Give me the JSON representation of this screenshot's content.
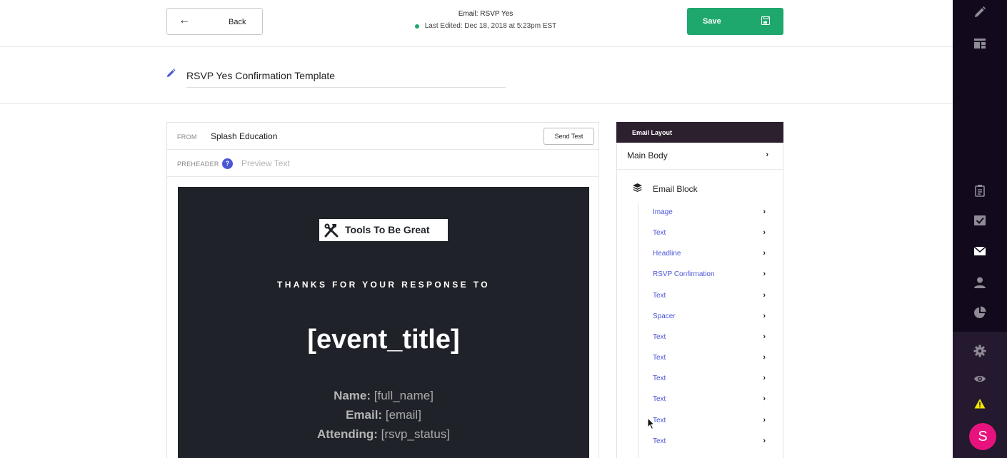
{
  "colors": {
    "accent_green": "#1fa86d",
    "accent_blue": "#4a55d6",
    "link_blue": "#4a55d6",
    "rail_dark": "#120a1c",
    "rail_lower": "#24192e",
    "avatar_pink": "#e8127e",
    "warning_yellow": "#f2e600"
  },
  "header": {
    "back_label": "Back",
    "back_icon": "arrow-left-icon",
    "doc_title": "Email: RSVP Yes",
    "last_edited": "Last Edited: Dec 18, 2018 at 5:23pm EST",
    "save_label": "Save",
    "save_icon": "floppy-disk-icon"
  },
  "template": {
    "name": "RSVP Yes Confirmation Template",
    "edit_icon": "pencil-icon"
  },
  "editor": {
    "from_label": "FROM",
    "from_value": "Splash Education",
    "send_test_label": "Send Test",
    "preheader_label": "PREHEADER",
    "help_glyph": "?",
    "preheader_placeholder": "Preview Text"
  },
  "email": {
    "logo_text": "Tools To Be Great",
    "logo_icon": "hammer-wrench-icon",
    "thanks_text": "THANKS FOR YOUR RESPONSE TO",
    "event_title": "[event_title]",
    "details": [
      {
        "label": "Name:",
        "value": "[full_name]"
      },
      {
        "label": "Email:",
        "value": "[email]"
      },
      {
        "label": "Attending:",
        "value": "[rsvp_status]"
      }
    ]
  },
  "layout_panel": {
    "header": "Email Layout",
    "main_body_label": "Main Body",
    "email_block_label": "Email Block",
    "email_block_icon": "layers-icon",
    "items": [
      "Image",
      "Text",
      "Headline",
      "RSVP Confirmation",
      "Text",
      "Spacer",
      "Text",
      "Text",
      "Text",
      "Text",
      "Text",
      "Text"
    ]
  },
  "rail": {
    "top_icons": [
      "pencil-icon",
      "layout-icon"
    ],
    "middle_icons": [
      "clipboard-icon",
      "checkbox-icon",
      "envelope-icon",
      "person-icon",
      "pie-chart-icon"
    ],
    "lower_icons": [
      "gear-icon",
      "eye-icon",
      "warning-icon"
    ],
    "avatar_letter": "S"
  }
}
